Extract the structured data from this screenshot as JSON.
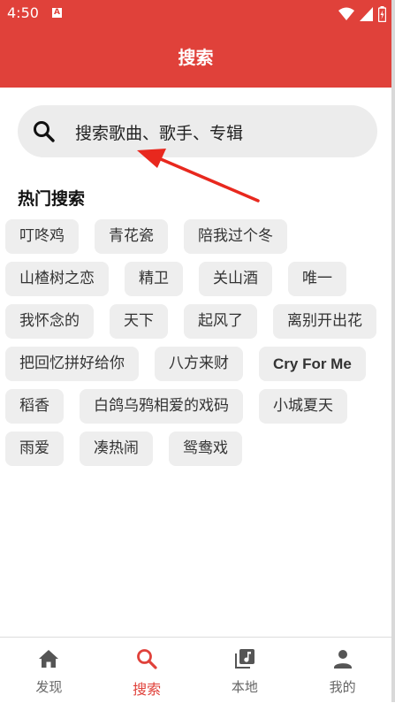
{
  "status_bar": {
    "time": "4:50",
    "a_badge": "A"
  },
  "app_bar": {
    "title": "搜索"
  },
  "search": {
    "placeholder": "搜索歌曲、歌手、专辑"
  },
  "hot_search": {
    "title": "热门搜索",
    "tags": [
      "叮咚鸡",
      "青花瓷",
      "陪我过个冬",
      "山楂树之恋",
      "精卫",
      "关山酒",
      "唯一",
      "我怀念的",
      "天下",
      "起风了",
      "离别开出花",
      "把回忆拼好给你",
      "八方来财",
      "Cry For Me",
      "稻香",
      "白鸽乌鸦相爱的戏码",
      "小城夏天",
      "雨爱",
      "凑热闹",
      "鸳鸯戏"
    ]
  },
  "bottom_nav": {
    "items": [
      {
        "label": "发现",
        "icon": "home-icon"
      },
      {
        "label": "搜索",
        "icon": "search-icon"
      },
      {
        "label": "本地",
        "icon": "music-library-icon"
      },
      {
        "label": "我的",
        "icon": "person-icon"
      }
    ],
    "active_index": 1
  },
  "colors": {
    "accent": "#e0413a",
    "chip_bg": "#eeeeee",
    "search_bg": "#ececec"
  }
}
